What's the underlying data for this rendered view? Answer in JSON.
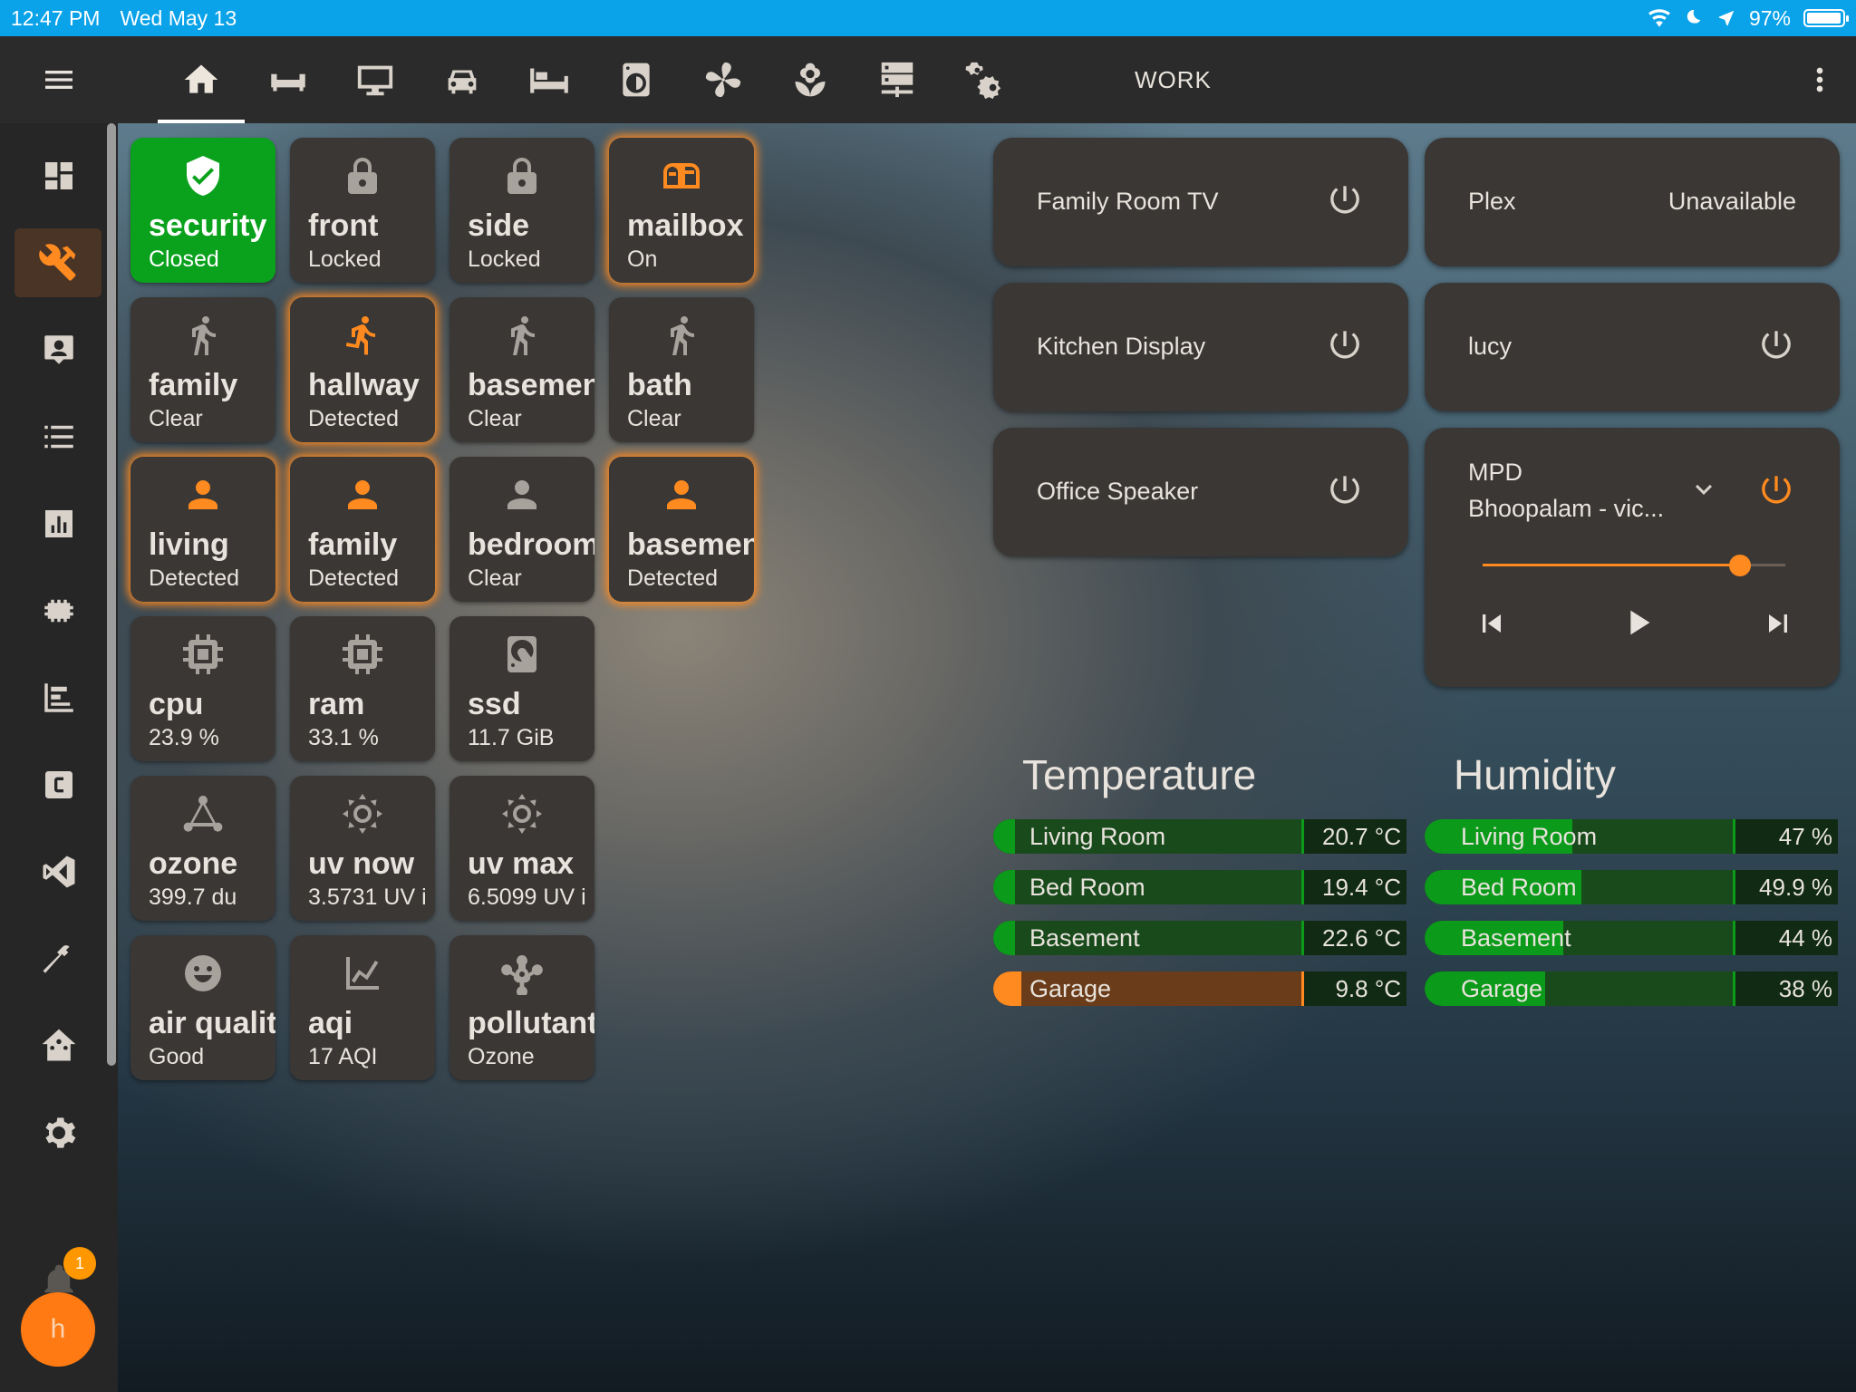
{
  "status_bar": {
    "time": "12:47 PM",
    "date": "Wed May 13",
    "battery": "97%",
    "battery_level": 0.97
  },
  "app_bar": {
    "view_title": "WORK",
    "tabs": [
      "home-icon",
      "sofa-icon",
      "monitor-icon",
      "car-icon",
      "bed-icon",
      "washing-machine-icon",
      "fan-icon",
      "flower-icon",
      "server-icon",
      "cogs-icon"
    ],
    "active_tab": 0
  },
  "sidebar": {
    "items": [
      "dashboard-icon",
      "tools-icon",
      "account-box-icon",
      "list-icon",
      "chart-icon",
      "memory-icon",
      "timeline-icon",
      "code-c-icon",
      "vscode-icon",
      "hammer-icon",
      "home-assistant-icon",
      "settings-icon"
    ],
    "active_index": 1,
    "notifications_count": "1",
    "user_initial": "h"
  },
  "tiles": [
    {
      "name": "security",
      "state": "Closed",
      "icon": "shield-check-icon",
      "style": "green"
    },
    {
      "name": "front",
      "state": "Locked",
      "icon": "lock-icon",
      "style": "off"
    },
    {
      "name": "side",
      "state": "Locked",
      "icon": "lock-icon",
      "style": "off"
    },
    {
      "name": "mailbox",
      "state": "On",
      "icon": "mailbox-icon",
      "style": "on"
    },
    {
      "name": "family",
      "state": "Clear",
      "icon": "walk-icon",
      "style": "off"
    },
    {
      "name": "hallway",
      "state": "Detected",
      "icon": "run-icon",
      "style": "on"
    },
    {
      "name": "basemen",
      "state": "Clear",
      "icon": "walk-icon",
      "style": "off"
    },
    {
      "name": "bath",
      "state": "Clear",
      "icon": "walk-icon",
      "style": "off"
    },
    {
      "name": "living",
      "state": "Detected",
      "icon": "account-icon",
      "style": "on"
    },
    {
      "name": "family",
      "state": "Detected",
      "icon": "account-icon",
      "style": "on"
    },
    {
      "name": "bedroom",
      "state": "Clear",
      "icon": "account-icon",
      "style": "off"
    },
    {
      "name": "basemen",
      "state": "Detected",
      "icon": "account-icon",
      "style": "on"
    },
    {
      "name": "cpu",
      "state": "23.9 %",
      "icon": "chip-icon",
      "style": "off"
    },
    {
      "name": "ram",
      "state": "33.1 %",
      "icon": "chip-icon",
      "style": "off"
    },
    {
      "name": "ssd",
      "state": "11.7 GiB",
      "icon": "harddisk-icon",
      "style": "off"
    },
    {
      "name": "ozone",
      "state": "399.7 du",
      "icon": "molecule-icon",
      "style": "off"
    },
    {
      "name": "uv now",
      "state": "3.5731 UV i",
      "icon": "sun-icon",
      "style": "off"
    },
    {
      "name": "uv max",
      "state": "6.5099 UV i",
      "icon": "sun-icon",
      "style": "off"
    },
    {
      "name": "air quality",
      "state": "Good",
      "icon": "smile-icon",
      "style": "off"
    },
    {
      "name": "aqi",
      "state": "17 AQI",
      "icon": "chart-line-icon",
      "style": "off"
    },
    {
      "name": "pollutant",
      "state": "Ozone",
      "icon": "biohazard-icon",
      "style": "off"
    }
  ],
  "media": {
    "family_room_tv": {
      "name": "Family Room TV"
    },
    "plex": {
      "name": "Plex",
      "status": "Unavailable"
    },
    "kitchen_display": {
      "name": "Kitchen Display"
    },
    "lucy": {
      "name": "lucy"
    },
    "office_speaker": {
      "name": "Office Speaker"
    },
    "mpd": {
      "name": "MPD",
      "track": "Bhoopalam - vic...",
      "volume": 0.85
    }
  },
  "temperature": {
    "title": "Temperature",
    "rows": [
      {
        "label": "Living Room",
        "value": "20.7 °C",
        "fraction": 0.07,
        "color": "green"
      },
      {
        "label": "Bed Room",
        "value": "19.4 °C",
        "fraction": 0.07,
        "color": "green"
      },
      {
        "label": "Basement",
        "value": "22.6 °C",
        "fraction": 0.07,
        "color": "green"
      },
      {
        "label": "Garage",
        "value": "9.8 °C",
        "fraction": 0.09,
        "color": "orange"
      }
    ]
  },
  "humidity": {
    "title": "Humidity",
    "rows": [
      {
        "label": "Living Room",
        "value": "47 %",
        "fraction": 0.48,
        "color": "green"
      },
      {
        "label": "Bed Room",
        "value": "49.9 %",
        "fraction": 0.51,
        "color": "green"
      },
      {
        "label": "Basement",
        "value": "44 %",
        "fraction": 0.45,
        "color": "green"
      },
      {
        "label": "Garage",
        "value": "38 %",
        "fraction": 0.39,
        "color": "green"
      }
    ]
  },
  "colors": {
    "accent": "#ff8a1f",
    "green": "#0aa11c",
    "status_bar": "#0aa2e8",
    "tile": "#3a3735"
  }
}
